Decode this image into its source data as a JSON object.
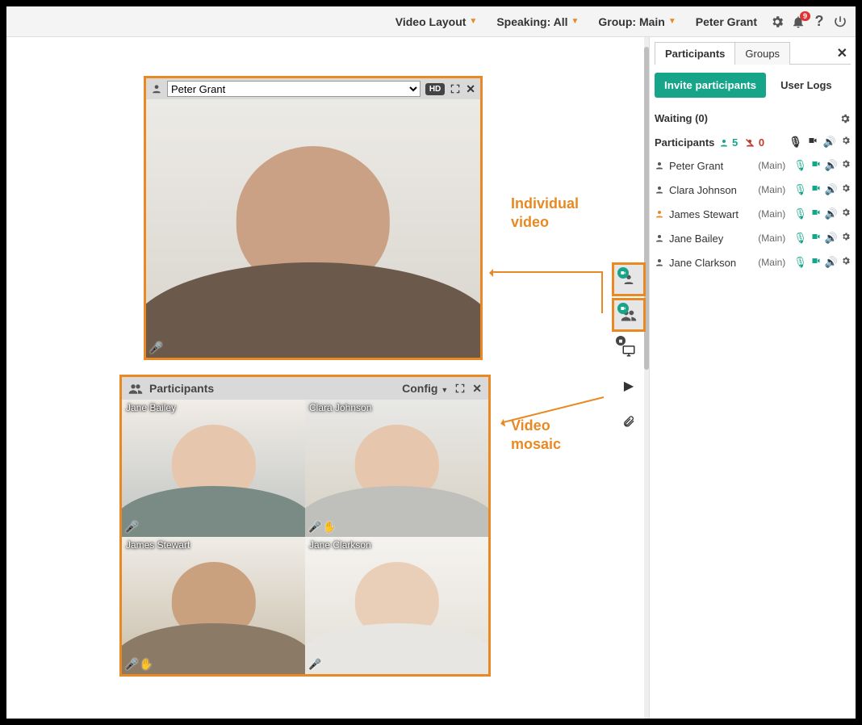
{
  "colors": {
    "accent": "#e88924",
    "teal": "#17a589",
    "danger": "#c0392b"
  },
  "topbar": {
    "videoLayout": "Video Layout",
    "speaking": "Speaking: All",
    "group": "Group: Main",
    "user": "Peter Grant",
    "bellCount": "9"
  },
  "annotations": {
    "individual": "Individual\nvideo",
    "mosaic": "Video\nmosaic"
  },
  "singleVideo": {
    "selected": "Peter Grant",
    "hd": "HD"
  },
  "mosaic": {
    "title": "Participants",
    "config": "Config",
    "tiles": [
      {
        "name": "Jane Bailey"
      },
      {
        "name": "Clara Johnson"
      },
      {
        "name": "James Stewart"
      },
      {
        "name": "Jane Clarkson"
      }
    ]
  },
  "sidebar": {
    "tabs": {
      "participants": "Participants",
      "groups": "Groups"
    },
    "invite": "Invite participants",
    "userLogs": "User Logs",
    "waiting": {
      "label": "Waiting (0)"
    },
    "participantsHeader": "Participants",
    "counts": {
      "present": "5",
      "raised": "0"
    },
    "rows": [
      {
        "name": "Peter Grant",
        "group": "(Main)",
        "host": false
      },
      {
        "name": "Clara Johnson",
        "group": "(Main)",
        "host": false
      },
      {
        "name": "James Stewart",
        "group": "(Main)",
        "host": true
      },
      {
        "name": "Jane Bailey",
        "group": "(Main)",
        "host": false
      },
      {
        "name": "Jane Clarkson",
        "group": "(Main)",
        "host": false
      }
    ]
  }
}
